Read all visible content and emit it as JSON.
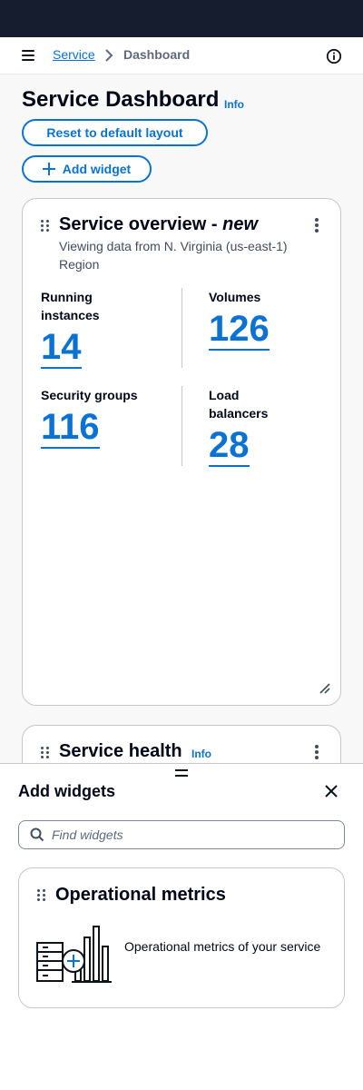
{
  "breadcrumb": {
    "service": "Service",
    "current": "Dashboard"
  },
  "page": {
    "title": "Service Dashboard",
    "info": "Info"
  },
  "buttons": {
    "reset": "Reset to default layout",
    "add_widget": "Add widget"
  },
  "overview": {
    "title": "Service overview - ",
    "title_emphasis": "new",
    "description": "Viewing data from N. Virginia (us-east-1) Region",
    "metrics": [
      {
        "label": "Running instances",
        "value": "14"
      },
      {
        "label": "Volumes",
        "value": "126"
      },
      {
        "label": "Security groups",
        "value": "116"
      },
      {
        "label": "Load balancers",
        "value": "28"
      }
    ]
  },
  "health": {
    "title": "Service health",
    "info": "Info"
  },
  "panel": {
    "title": "Add widgets",
    "search_placeholder": "Find widgets",
    "widget": {
      "title": "Operational metrics",
      "description": "Operational metrics of your service"
    }
  },
  "colors": {
    "link": "#0972d3",
    "topbar": "#161d2e",
    "text": "#000716"
  },
  "icons": [
    "menu-icon",
    "chevron-right-icon",
    "info-circle-icon",
    "plus-icon",
    "drag-handle-icon",
    "more-vertical-icon",
    "resize-icon",
    "close-icon",
    "search-icon"
  ]
}
